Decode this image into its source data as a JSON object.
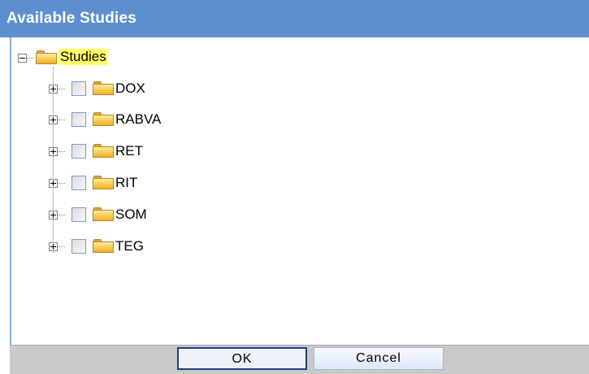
{
  "dialog": {
    "title": "Available Studies",
    "colors": {
      "title_bar": "#5b8fd0",
      "root_highlight": "#ffff66",
      "button_bar": "#c9c9c9"
    }
  },
  "tree": {
    "root": {
      "label": "Studies",
      "expanded": true,
      "icon": "folder-icon"
    },
    "children": [
      {
        "label": "DOX",
        "expanded": false,
        "checked": false,
        "icon": "folder-icon"
      },
      {
        "label": "RABVA",
        "expanded": false,
        "checked": false,
        "icon": "folder-icon"
      },
      {
        "label": "RET",
        "expanded": false,
        "checked": false,
        "icon": "folder-icon"
      },
      {
        "label": "RIT",
        "expanded": false,
        "checked": false,
        "icon": "folder-icon"
      },
      {
        "label": "SOM",
        "expanded": false,
        "checked": false,
        "icon": "folder-icon"
      },
      {
        "label": "TEG",
        "expanded": false,
        "checked": false,
        "icon": "folder-icon"
      }
    ]
  },
  "buttons": {
    "ok_label": "OK",
    "cancel_label": "Cancel"
  }
}
